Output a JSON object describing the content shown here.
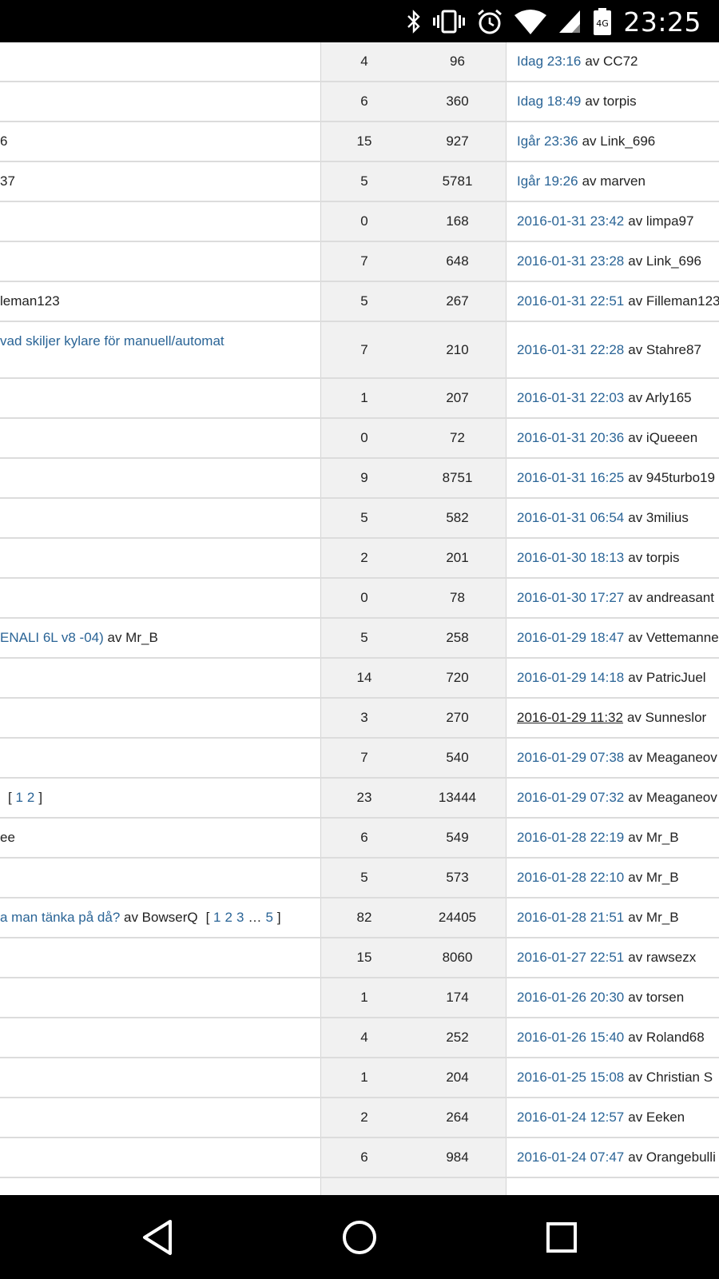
{
  "status_bar": {
    "time": "23:25",
    "network_badge": "4G",
    "icons": [
      "bluetooth-icon",
      "vibrate-icon",
      "alarm-icon",
      "wifi-icon",
      "signal-icon",
      "battery-icon"
    ]
  },
  "colors": {
    "link": "#2a6496",
    "stat_column_bg": "#f1f1f1",
    "row_border": "#dcdcdc"
  },
  "rows": [
    {
      "topic": "",
      "topic_link": "",
      "topic_suffix": "",
      "pages": [],
      "replies": "4",
      "views": "96",
      "last_date": "Idag 23:16",
      "last_by": "av CC72"
    },
    {
      "topic": "",
      "topic_link": "",
      "topic_suffix": "",
      "pages": [],
      "replies": "6",
      "views": "360",
      "last_date": "Idag 18:49",
      "last_by": "av torpis"
    },
    {
      "topic": "6",
      "topic_link": "",
      "topic_suffix": "",
      "pages": [],
      "replies": "15",
      "views": "927",
      "last_date": "Igår 23:36",
      "last_by": "av Link_696"
    },
    {
      "topic": "37",
      "topic_link": "",
      "topic_suffix": "",
      "pages": [],
      "replies": "5",
      "views": "5781",
      "last_date": "Igår 19:26",
      "last_by": "av marven"
    },
    {
      "topic": "",
      "topic_link": "",
      "topic_suffix": "",
      "pages": [],
      "replies": "0",
      "views": "168",
      "last_date": "2016-01-31 23:42",
      "last_by": "av limpa97"
    },
    {
      "topic": "",
      "topic_link": "",
      "topic_suffix": "",
      "pages": [],
      "replies": "7",
      "views": "648",
      "last_date": "2016-01-31 23:28",
      "last_by": "av Link_696"
    },
    {
      "topic": "leman123",
      "topic_link": "",
      "topic_suffix": "",
      "pages": [],
      "replies": "5",
      "views": "267",
      "last_date": "2016-01-31 22:51",
      "last_by": "av Filleman123"
    },
    {
      "topic": "",
      "topic_link": "vad skiljer kylare för manuell/automat",
      "topic_suffix": "",
      "pages": [],
      "replies": "7",
      "views": "210",
      "last_date": "2016-01-31 22:28",
      "last_by": "av Stahre87"
    },
    {
      "topic": "",
      "topic_link": "",
      "topic_suffix": "",
      "pages": [],
      "replies": "1",
      "views": "207",
      "last_date": "2016-01-31 22:03",
      "last_by": "av Arly165"
    },
    {
      "topic": "",
      "topic_link": "",
      "topic_suffix": "",
      "pages": [],
      "replies": "0",
      "views": "72",
      "last_date": "2016-01-31 20:36",
      "last_by": "av iQueeen"
    },
    {
      "topic": "",
      "topic_link": "",
      "topic_suffix": "",
      "pages": [],
      "replies": "9",
      "views": "8751",
      "last_date": "2016-01-31 16:25",
      "last_by": "av 945turbo19"
    },
    {
      "topic": "",
      "topic_link": "",
      "topic_suffix": "",
      "pages": [],
      "replies": "5",
      "views": "582",
      "last_date": "2016-01-31 06:54",
      "last_by": "av 3milius"
    },
    {
      "topic": "",
      "topic_link": "",
      "topic_suffix": "",
      "pages": [],
      "replies": "2",
      "views": "201",
      "last_date": "2016-01-30 18:13",
      "last_by": "av torpis"
    },
    {
      "topic": "",
      "topic_link": "",
      "topic_suffix": "",
      "pages": [],
      "replies": "0",
      "views": "78",
      "last_date": "2016-01-30 17:27",
      "last_by": "av andreasant"
    },
    {
      "topic": "",
      "topic_link": "ENALI 6L v8 -04)",
      "topic_suffix": " av Mr_B",
      "pages": [],
      "replies": "5",
      "views": "258",
      "last_date": "2016-01-29 18:47",
      "last_by": "av Vettemanne"
    },
    {
      "topic": "",
      "topic_link": "",
      "topic_suffix": "",
      "pages": [],
      "replies": "14",
      "views": "720",
      "last_date": "2016-01-29 14:18",
      "last_by": "av PatricJuel"
    },
    {
      "topic": "",
      "topic_link": "",
      "topic_suffix": "",
      "pages": [],
      "replies": "3",
      "views": "270",
      "last_date": "2016-01-29 11:32",
      "last_by": "av Sunneslor",
      "last_date_underlined": true
    },
    {
      "topic": "",
      "topic_link": "",
      "topic_suffix": "",
      "pages": [],
      "replies": "7",
      "views": "540",
      "last_date": "2016-01-29 07:38",
      "last_by": "av Meaganeov"
    },
    {
      "topic": "",
      "topic_link": "",
      "topic_suffix": "",
      "pages": [
        "1",
        "2"
      ],
      "replies": "23",
      "views": "13444",
      "last_date": "2016-01-29 07:32",
      "last_by": "av Meaganeov"
    },
    {
      "topic": "ee",
      "topic_link": "",
      "topic_suffix": "",
      "pages": [],
      "replies": "6",
      "views": "549",
      "last_date": "2016-01-28 22:19",
      "last_by": "av Mr_B"
    },
    {
      "topic": "",
      "topic_link": "",
      "topic_suffix": "",
      "pages": [],
      "replies": "5",
      "views": "573",
      "last_date": "2016-01-28 22:10",
      "last_by": "av Mr_B"
    },
    {
      "topic": "",
      "topic_link": "a man tänka på då?",
      "topic_suffix": " av BowserQ",
      "pages": [
        "1",
        "2",
        "3",
        "…",
        "5"
      ],
      "replies": "82",
      "views": "24405",
      "last_date": "2016-01-28 21:51",
      "last_by": "av Mr_B"
    },
    {
      "topic": "",
      "topic_link": "",
      "topic_suffix": "",
      "pages": [],
      "replies": "15",
      "views": "8060",
      "last_date": "2016-01-27 22:51",
      "last_by": "av rawsezx"
    },
    {
      "topic": "",
      "topic_link": "",
      "topic_suffix": "",
      "pages": [],
      "replies": "1",
      "views": "174",
      "last_date": "2016-01-26 20:30",
      "last_by": "av torsen"
    },
    {
      "topic": "",
      "topic_link": "",
      "topic_suffix": "",
      "pages": [],
      "replies": "4",
      "views": "252",
      "last_date": "2016-01-26 15:40",
      "last_by": "av Roland68"
    },
    {
      "topic": "",
      "topic_link": "",
      "topic_suffix": "",
      "pages": [],
      "replies": "1",
      "views": "204",
      "last_date": "2016-01-25 15:08",
      "last_by": "av Christian S"
    },
    {
      "topic": "",
      "topic_link": "",
      "topic_suffix": "",
      "pages": [],
      "replies": "2",
      "views": "264",
      "last_date": "2016-01-24 12:57",
      "last_by": "av Eeken"
    },
    {
      "topic": "",
      "topic_link": "",
      "topic_suffix": "",
      "pages": [],
      "replies": "6",
      "views": "984",
      "last_date": "2016-01-24 07:47",
      "last_by": "av Orangebulli"
    }
  ],
  "nav_bar": {
    "buttons": [
      "back-icon",
      "home-icon",
      "recents-icon"
    ]
  }
}
